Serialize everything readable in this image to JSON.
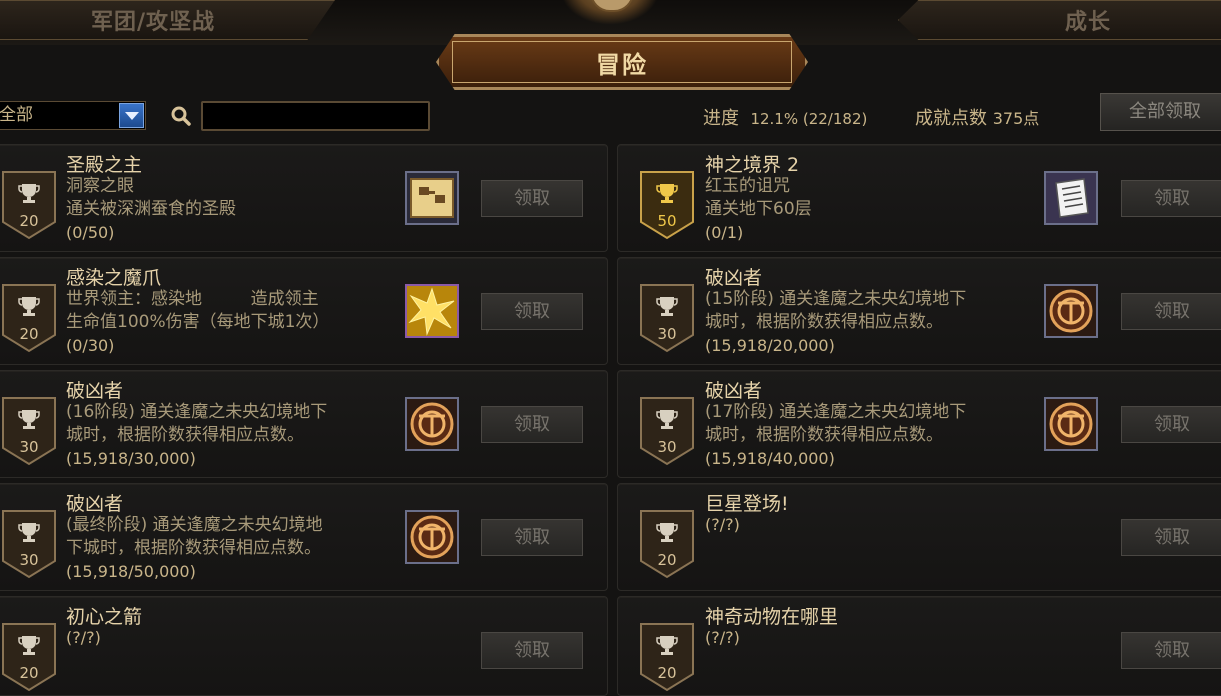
{
  "tabs": {
    "left": "军团/攻坚战",
    "center": "冒险",
    "right": "成长"
  },
  "filter": {
    "selected": "全部",
    "search_value": ""
  },
  "summary": {
    "progress_label": "进度",
    "progress_value": "12.1% (22/182)",
    "points_label": "成就点数",
    "points_value": "375点",
    "claim_all": "全部领取"
  },
  "colors": {
    "gold_badge": "#f0c84a",
    "silver_badge": "#d8c39a"
  },
  "achievements": [
    {
      "title": "圣殿之主",
      "desc": "洞察之眼\n通关被深渊蚕食的圣殿",
      "progress": "(0/50)",
      "points": "20",
      "badge": "silver",
      "icon": "map-icon",
      "claim": "领取"
    },
    {
      "title": "神之境界 2",
      "desc": "红玉的诅咒\n通关地下60层",
      "progress": "(0/1)",
      "points": "50",
      "badge": "gold",
      "icon": "scroll-icon",
      "claim": "领取"
    },
    {
      "title": "感染之魔爪",
      "desc": "世界领主：感染地         造成领主\n生命值100%伤害（每地下城1次）",
      "progress": "(0/30)",
      "points": "20",
      "badge": "silver",
      "icon": "burst-icon",
      "claim": "领取"
    },
    {
      "title": "破凶者",
      "desc": "(15阶段) 通关逢魔之未央幻境地下\n城时，根据阶数获得相应点数。",
      "progress": "(15,918/20,000)",
      "points": "30",
      "badge": "silver",
      "icon": "seal-icon",
      "claim": "领取"
    },
    {
      "title": "破凶者",
      "desc": "(16阶段) 通关逢魔之未央幻境地下\n城时，根据阶数获得相应点数。",
      "progress": "(15,918/30,000)",
      "points": "30",
      "badge": "silver",
      "icon": "seal-icon",
      "claim": "领取"
    },
    {
      "title": "破凶者",
      "desc": "(17阶段) 通关逢魔之未央幻境地下\n城时，根据阶数获得相应点数。",
      "progress": "(15,918/40,000)",
      "points": "30",
      "badge": "silver",
      "icon": "seal-icon",
      "claim": "领取"
    },
    {
      "title": "破凶者",
      "desc": "(最终阶段) 通关逢魔之未央幻境地\n下城时，根据阶数获得相应点数。",
      "progress": "(15,918/50,000)",
      "points": "30",
      "badge": "silver",
      "icon": "seal-icon",
      "claim": "领取"
    },
    {
      "title": "巨星登场!",
      "desc": "",
      "progress": "(?/?)",
      "points": "20",
      "badge": "silver",
      "icon": "",
      "claim": "领取"
    },
    {
      "title": "初心之箭",
      "desc": "",
      "progress": "(?/?)",
      "points": "20",
      "badge": "silver",
      "icon": "",
      "claim": "领取"
    },
    {
      "title": "神奇动物在哪里",
      "desc": "",
      "progress": "(?/?)",
      "points": "20",
      "badge": "silver",
      "icon": "",
      "claim": "领取"
    }
  ]
}
